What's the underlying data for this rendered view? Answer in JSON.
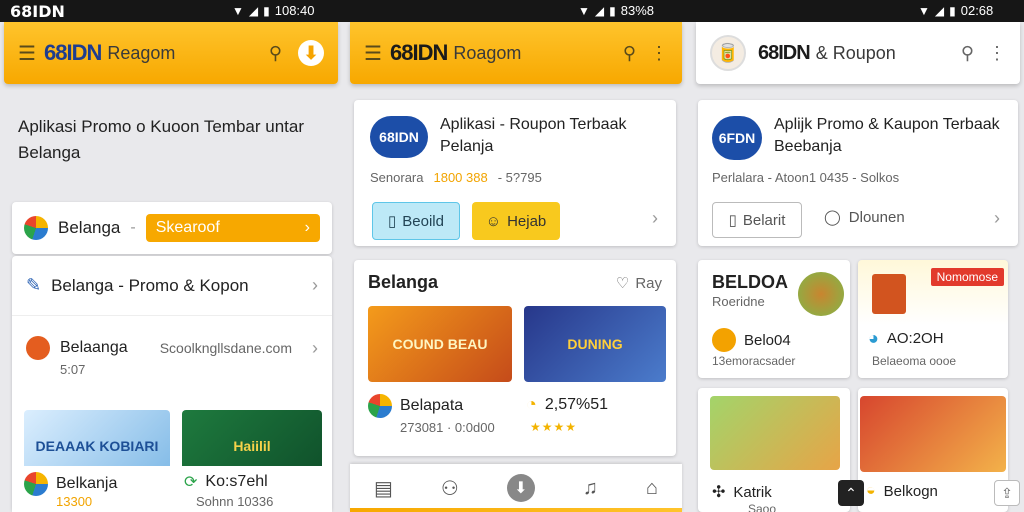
{
  "status_bar": {
    "brand": "68IDN",
    "times": [
      "108:40",
      "83%8",
      "02:68"
    ]
  },
  "colors": {
    "accent": "#f7a800",
    "brand_blue": "#1e3d8f"
  },
  "panel1": {
    "appbar": {
      "logo": "68IDN",
      "subtitle": "Reagom"
    },
    "headline": "Aplikasi Promo o Kuoon Tembar untar Belanga",
    "belanja_card": {
      "title": "Belanga",
      "cta": "Skearoof"
    },
    "list_items": [
      {
        "title": "Belanga - Promo & Kopon"
      },
      {
        "title": "Belaanga",
        "detail": "Scoolkngllsdane.com",
        "sub": "5:07"
      }
    ],
    "promos": [
      {
        "label": "DEAAAK KOBIARI"
      },
      {
        "label": "Haiilil"
      }
    ],
    "footer": [
      {
        "title": "Belkanja",
        "value": "13300"
      },
      {
        "title": "Ko:s7ehl",
        "value": "Sohnn 10336"
      }
    ]
  },
  "panel2": {
    "appbar": {
      "logo": "68IDN",
      "subtitle": "Roagom"
    },
    "app_card": {
      "logo": "68IDN",
      "title": "Aplikasi - Roupon Terbaak Pelanja",
      "meta_label": "Senorara",
      "meta_value": "1800 388",
      "meta_extra": "- 5?795",
      "btn1": "Beoild",
      "btn2": "Hejab"
    },
    "section": {
      "title": "Belanga",
      "right": "Ray",
      "items": [
        {
          "image_label": "COUND BEAU",
          "title": "Belapata",
          "meta": "273081 · 0:0d00"
        },
        {
          "image_label": "DUNING",
          "title": "2,57%51",
          "meta": "★★★★"
        }
      ]
    }
  },
  "panel3": {
    "appbar": {
      "logo": "68IDN",
      "subtitle": "& Roupon"
    },
    "app_card": {
      "logo": "6FDN",
      "title": "Aplijk Promo & Kaupon Terbaak Beebanja",
      "meta": "Perlalara - Atoon1 0435 - Solkos",
      "btn1": "Belarit",
      "btn2": "Dlounen"
    },
    "grid": [
      {
        "header": "BELDOA",
        "sub": "Roeridne",
        "title": "Belo04",
        "meta": "13emoracsader"
      },
      {
        "badge": "Nomomose",
        "title": "AO:2OH",
        "meta": "Belaeoma oooe"
      },
      {
        "title": "Katrik",
        "meta": "Saoo"
      },
      {
        "title": "Belkogn",
        "meta": ""
      }
    ]
  }
}
